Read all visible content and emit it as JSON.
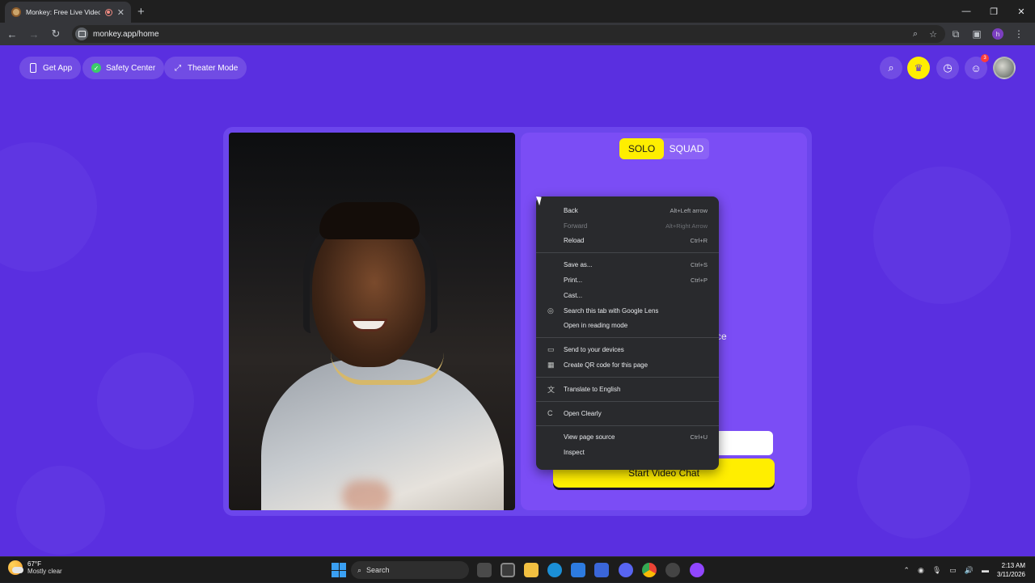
{
  "browser": {
    "tab_title": "Monkey: Free Live Video Ch",
    "url": "monkey.app/home",
    "new_tab": "+",
    "tab_close": "✕",
    "window_controls": [
      "—",
      "❐",
      "✕"
    ]
  },
  "header": {
    "get_app": "Get App",
    "safety_center": "Safety Center",
    "theater_mode": "Theater Mode",
    "messages_badge": "3"
  },
  "mode": {
    "solo": "SOLO",
    "squad": "SQUAD"
  },
  "panel": {
    "partial_text": "ce",
    "start_button": "Start Video Chat"
  },
  "context_menu": {
    "items": [
      {
        "label": "Back",
        "shortcut": "Alt+Left arrow",
        "icon": "",
        "disabled": false
      },
      {
        "label": "Forward",
        "shortcut": "Alt+Right Arrow",
        "icon": "",
        "disabled": true
      },
      {
        "label": "Reload",
        "shortcut": "Ctrl+R",
        "icon": "",
        "disabled": false
      },
      {
        "label": "Save as...",
        "shortcut": "Ctrl+S",
        "icon": "",
        "disabled": false
      },
      {
        "label": "Print...",
        "shortcut": "Ctrl+P",
        "icon": "",
        "disabled": false
      },
      {
        "label": "Cast...",
        "shortcut": "",
        "icon": "",
        "disabled": false
      },
      {
        "label": "Search this tab with Google Lens",
        "shortcut": "",
        "icon": "lens-icon",
        "disabled": false
      },
      {
        "label": "Open in reading mode",
        "shortcut": "",
        "icon": "",
        "disabled": false
      },
      {
        "label": "Send to your devices",
        "shortcut": "",
        "icon": "devices-icon",
        "disabled": false
      },
      {
        "label": "Create QR code for this page",
        "shortcut": "",
        "icon": "qr-icon",
        "disabled": false
      },
      {
        "label": "Translate to English",
        "shortcut": "",
        "icon": "translate-icon",
        "disabled": false
      },
      {
        "label": "Open Clearly",
        "shortcut": "",
        "icon": "clearly-icon",
        "disabled": false
      },
      {
        "label": "View page source",
        "shortcut": "Ctrl+U",
        "icon": "",
        "disabled": false
      },
      {
        "label": "Inspect",
        "shortcut": "",
        "icon": "",
        "disabled": false
      }
    ]
  },
  "taskbar": {
    "temperature": "67°F",
    "condition": "Mostly clear",
    "search": "Search",
    "time": "2:13 AM",
    "date": "3/11/2026"
  },
  "colors": {
    "page_bg": "#5a2fe0",
    "panel_bg": "#7b4df5",
    "accent_yellow": "#ffee00"
  }
}
